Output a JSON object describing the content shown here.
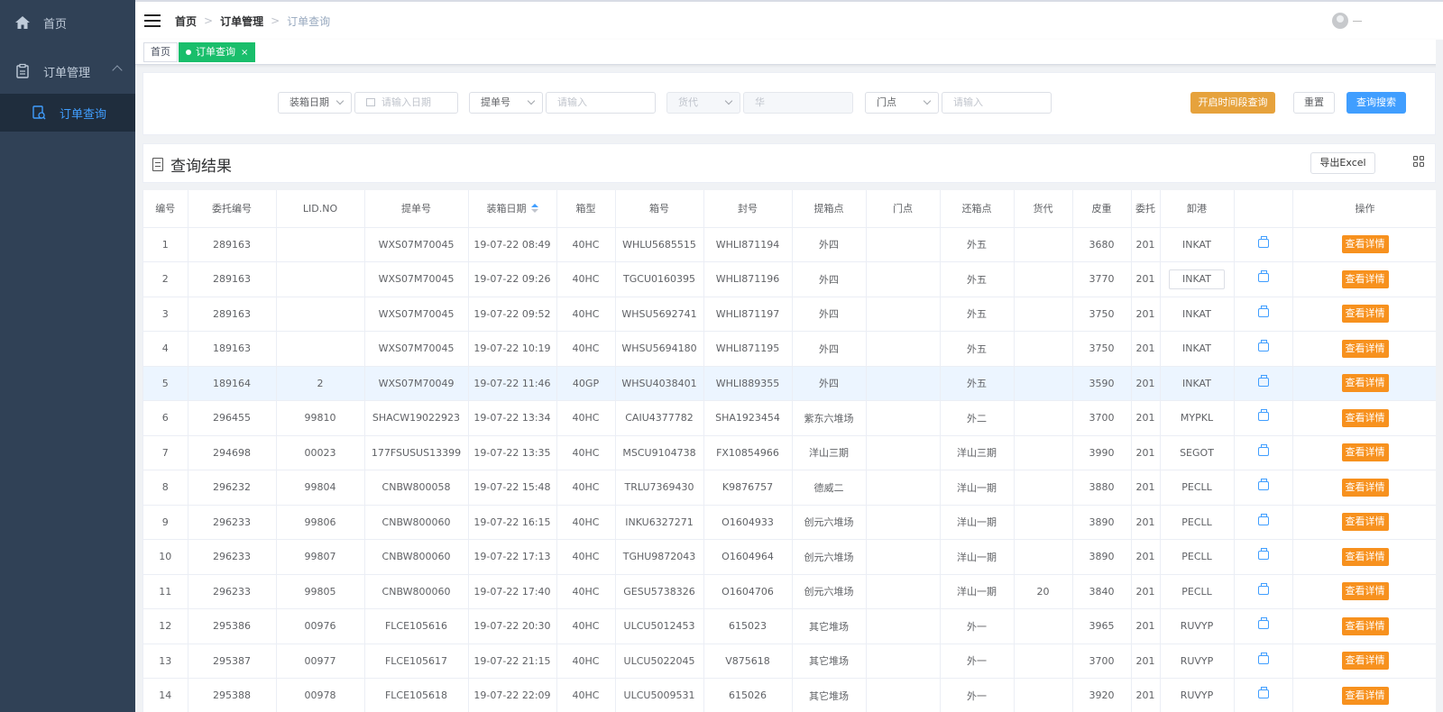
{
  "sidebar": {
    "items": [
      {
        "label": "首页",
        "icon": "home-icon"
      },
      {
        "label": "订单管理",
        "icon": "clipboard-icon"
      },
      {
        "label": "订单查询",
        "icon": "document-search-icon"
      }
    ]
  },
  "header": {
    "breadcrumb": [
      "首页",
      "订单管理",
      "订单查询"
    ]
  },
  "tags": [
    {
      "label": "首页"
    },
    {
      "label": "订单查询",
      "close": "×"
    }
  ],
  "filters": {
    "date_type": "装箱日期",
    "date_placeholder": "请输入日期",
    "bill_type": "提单号",
    "bill_placeholder": "请输入",
    "agent_type": "货代",
    "agent_value": "华",
    "door_type": "门点",
    "door_placeholder": "请输入",
    "btn_time_range": "开启时间段查询",
    "btn_reset": "重置",
    "btn_search": "查询搜索"
  },
  "results": {
    "title": "查询结果",
    "export": "导出Excel"
  },
  "table": {
    "columns": [
      "编号",
      "委托编号",
      "LID.NO",
      "提单号",
      "装箱日期",
      "箱型",
      "箱号",
      "封号",
      "提箱点",
      "门点",
      "还箱点",
      "货代",
      "皮重",
      "委托",
      "卸港",
      "",
      "操作"
    ],
    "action_label": "查看详情",
    "rows": [
      {
        "no": "1",
        "order": "289163",
        "lid": "",
        "bill": "WXS07M70045",
        "date": "19-07-22 08:49",
        "type": "40HC",
        "box": "WHLU5685515",
        "seal": "WHLI871194",
        "pickup": "外四",
        "door": "",
        "ret": "外五",
        "agent": "",
        "tare": "3680",
        "entrust": "201",
        "port": "INKAT"
      },
      {
        "no": "2",
        "order": "289163",
        "lid": "",
        "bill": "WXS07M70045",
        "date": "19-07-22 09:26",
        "type": "40HC",
        "box": "TGCU0160395",
        "seal": "WHLI871196",
        "pickup": "外四",
        "door": "",
        "ret": "外五",
        "agent": "",
        "tare": "3770",
        "entrust": "201",
        "port": "INKAT",
        "port_input": true
      },
      {
        "no": "3",
        "order": "289163",
        "lid": "",
        "bill": "WXS07M70045",
        "date": "19-07-22 09:52",
        "type": "40HC",
        "box": "WHSU5692741",
        "seal": "WHLI871197",
        "pickup": "外四",
        "door": "",
        "ret": "外五",
        "agent": "",
        "tare": "3750",
        "entrust": "201",
        "port": "INKAT"
      },
      {
        "no": "4",
        "order": "189163",
        "lid": "",
        "bill": "WXS07M70045",
        "date": "19-07-22 10:19",
        "type": "40HC",
        "box": "WHSU5694180",
        "seal": "WHLI871195",
        "pickup": "外四",
        "door": "",
        "ret": "外五",
        "agent": "",
        "tare": "3750",
        "entrust": "201",
        "port": "INKAT"
      },
      {
        "no": "5",
        "order": "189164",
        "lid": "2",
        "bill": "WXS07M70049",
        "date": "19-07-22 11:46",
        "type": "40GP",
        "box": "WHSU4038401",
        "seal": "WHLI889355",
        "pickup": "外四",
        "door": "",
        "ret": "外五",
        "agent": "",
        "tare": "3590",
        "entrust": "201",
        "port": "INKAT",
        "highlight": true
      },
      {
        "no": "6",
        "order": "296455",
        "lid": "99810",
        "bill": "SHACW19022923",
        "date": "19-07-22 13:34",
        "type": "40HC",
        "box": "CAIU4377782",
        "seal": "SHA1923454",
        "pickup": "紫东六堆场",
        "door": "",
        "ret": "外二",
        "agent": "",
        "tare": "3700",
        "entrust": "201",
        "port": "MYPKL"
      },
      {
        "no": "7",
        "order": "294698",
        "lid": "00023",
        "bill": "177FSUSUS13399",
        "date": "19-07-22 13:35",
        "type": "40HC",
        "box": "MSCU9104738",
        "seal": "FX10854966",
        "pickup": "洋山三期",
        "door": "",
        "ret": "洋山三期",
        "agent": "",
        "tare": "3990",
        "entrust": "201",
        "port": "SEGOT"
      },
      {
        "no": "8",
        "order": "296232",
        "lid": "99804",
        "bill": "CNBW800058",
        "date": "19-07-22 15:48",
        "type": "40HC",
        "box": "TRLU7369430",
        "seal": "K9876757",
        "pickup": "德威二",
        "door": "",
        "ret": "洋山一期",
        "agent": "",
        "tare": "3880",
        "entrust": "201",
        "port": "PECLL"
      },
      {
        "no": "9",
        "order": "296233",
        "lid": "99806",
        "bill": "CNBW800060",
        "date": "19-07-22 16:15",
        "type": "40HC",
        "box": "INKU6327271",
        "seal": "O1604933",
        "pickup": "创元六堆场",
        "door": "",
        "ret": "洋山一期",
        "agent": "",
        "tare": "3890",
        "entrust": "201",
        "port": "PECLL"
      },
      {
        "no": "10",
        "order": "296233",
        "lid": "99807",
        "bill": "CNBW800060",
        "date": "19-07-22 17:13",
        "type": "40HC",
        "box": "TGHU9872043",
        "seal": "O1604964",
        "pickup": "创元六堆场",
        "door": "",
        "ret": "洋山一期",
        "agent": "",
        "tare": "3890",
        "entrust": "201",
        "port": "PECLL"
      },
      {
        "no": "11",
        "order": "296233",
        "lid": "99805",
        "bill": "CNBW800060",
        "date": "19-07-22 17:40",
        "type": "40HC",
        "box": "GESU5738326",
        "seal": "O1604706",
        "pickup": "创元六堆场",
        "door": "",
        "ret": "洋山一期",
        "agent": "20",
        "tare": "3840",
        "entrust": "201",
        "port": "PECLL"
      },
      {
        "no": "12",
        "order": "295386",
        "lid": "00976",
        "bill": "FLCE105616",
        "date": "19-07-22 20:30",
        "type": "40HC",
        "box": "ULCU5012453",
        "seal": "615023",
        "pickup": "其它堆场",
        "door": "",
        "ret": "外一",
        "agent": "",
        "tare": "3965",
        "entrust": "201",
        "port": "RUVYP"
      },
      {
        "no": "13",
        "order": "295387",
        "lid": "00977",
        "bill": "FLCE105617",
        "date": "19-07-22 21:15",
        "type": "40HC",
        "box": "ULCU5022045",
        "seal": "V875618",
        "pickup": "其它堆场",
        "door": "",
        "ret": "外一",
        "agent": "",
        "tare": "3700",
        "entrust": "201",
        "port": "RUVYP"
      },
      {
        "no": "14",
        "order": "295388",
        "lid": "00978",
        "bill": "FLCE105618",
        "date": "19-07-22 22:09",
        "type": "40HC",
        "box": "ULCU5009531",
        "seal": "615026",
        "pickup": "其它堆场",
        "door": "",
        "ret": "外一",
        "agent": "",
        "tare": "3920",
        "entrust": "201",
        "port": "RUVYP"
      }
    ]
  },
  "colors": {
    "sidebar_bg": "#304156",
    "accent": "#409eff",
    "warning": "#e6a23c",
    "action": "#f7911e",
    "tag_active": "#19be6b"
  }
}
